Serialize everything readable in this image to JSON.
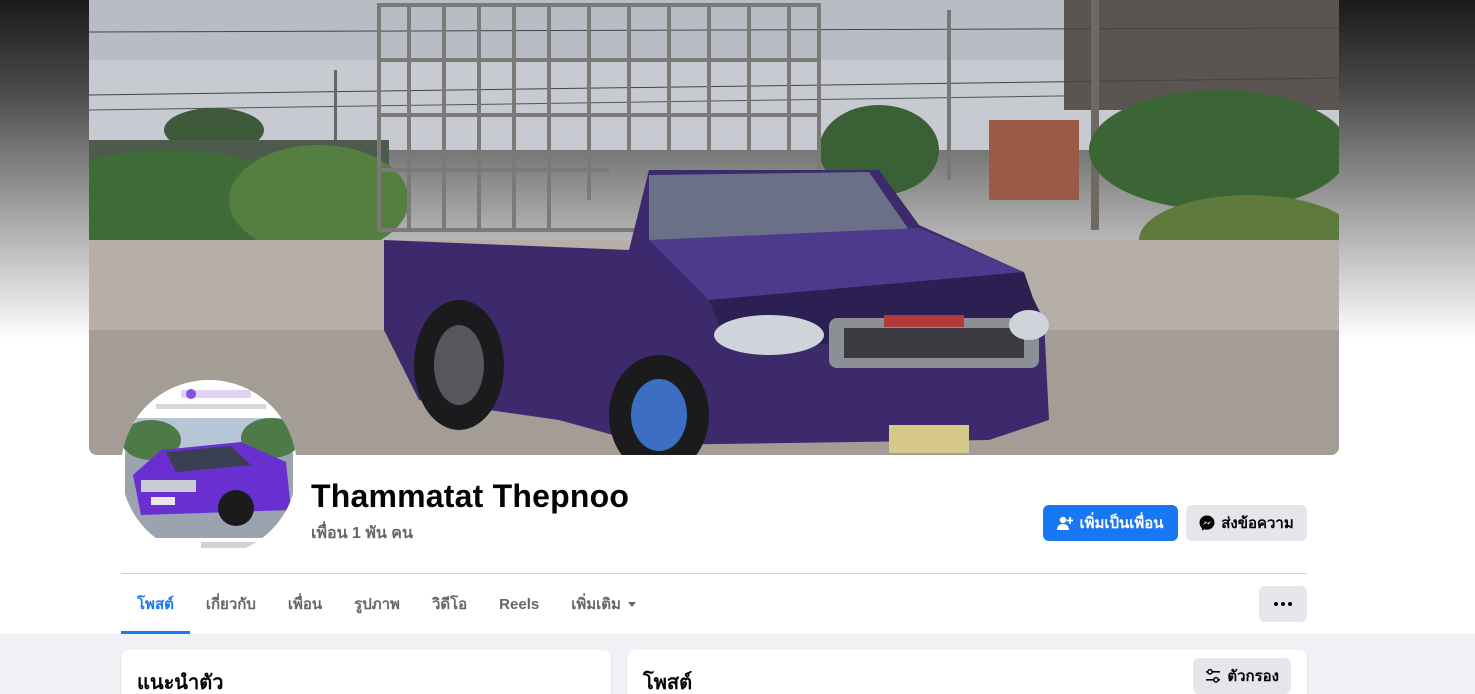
{
  "profile": {
    "name": "Thammatat Thepnoo",
    "friends_text": "เพื่อน 1 พัน คน"
  },
  "actions": {
    "add_friend_label": "เพิ่มเป็นเพื่อน",
    "message_label": "ส่งข้อความ"
  },
  "tabs": [
    {
      "label": "โพสต์",
      "active": true
    },
    {
      "label": "เกี่ยวกับ",
      "active": false
    },
    {
      "label": "เพื่อน",
      "active": false
    },
    {
      "label": "รูปภาพ",
      "active": false
    },
    {
      "label": "วิดีโอ",
      "active": false
    },
    {
      "label": "Reels",
      "active": false
    },
    {
      "label": "เพิ่มเติม",
      "active": false
    }
  ],
  "intro": {
    "title": "แนะนำตัว"
  },
  "posts": {
    "title": "โพสต์",
    "filter_label": "ตัวกรอง"
  },
  "colors": {
    "accent": "#1877f2",
    "secondary_button": "#e4e6eb",
    "muted_text": "#65676b",
    "page_background": "#f0f2f5"
  },
  "icons": {
    "add_friend": "person-plus-icon",
    "message": "messenger-icon",
    "more": "ellipsis-icon",
    "filter": "sliders-icon",
    "dropdown": "caret-down-icon"
  }
}
